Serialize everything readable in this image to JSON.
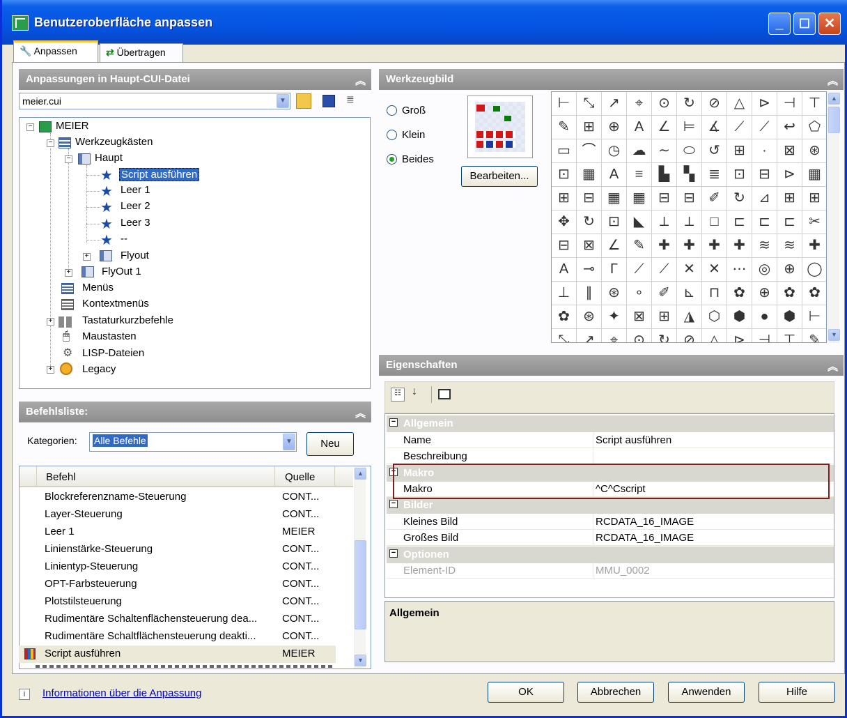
{
  "window": {
    "title": "Benutzeroberfläche anpassen",
    "minimize": "_",
    "maximize": "☐",
    "close": "✕"
  },
  "tabs": [
    {
      "label": "Anpassen"
    },
    {
      "label": "Übertragen"
    }
  ],
  "cui_panel": {
    "title": "Anpassungen in Haupt-CUI-Datei",
    "file": "meier.cui",
    "tree": [
      "MEIER",
      "Werkzeugkästen",
      "Haupt",
      "Script ausführen",
      "Leer 1",
      "Leer 2",
      "Leer 3",
      "--",
      "Flyout",
      "FlyOut 1",
      "Menüs",
      "Kontextmenüs",
      "Tastaturkurzbefehle",
      "Maustasten",
      "LISP-Dateien",
      "Legacy"
    ]
  },
  "commands": {
    "title": "Befehlsliste:",
    "category_label": "Kategorien:",
    "category_value": "Alle Befehle",
    "new_button": "Neu",
    "col_command": "Befehl",
    "col_source": "Quelle",
    "rows": [
      {
        "name": "Blockreferenzname-Steuerung",
        "source": "CONT..."
      },
      {
        "name": "Layer-Steuerung",
        "source": "CONT..."
      },
      {
        "name": "Leer 1",
        "source": "MEIER"
      },
      {
        "name": "Linienstärke-Steuerung",
        "source": "CONT..."
      },
      {
        "name": "Linientyp-Steuerung",
        "source": "CONT..."
      },
      {
        "name": "OPT-Farbsteuerung",
        "source": "CONT..."
      },
      {
        "name": "Plotstilsteuerung",
        "source": "CONT..."
      },
      {
        "name": "Rudimentäre Schaltenflächensteuerung dea...",
        "source": "CONT..."
      },
      {
        "name": "Rudimentäre Schaltflächensteuerung deakti...",
        "source": "CONT..."
      },
      {
        "name": "Script ausführen",
        "source": "MEIER"
      }
    ]
  },
  "toolimage": {
    "title": "Werkzeugbild",
    "size_large": "Groß",
    "size_small": "Klein",
    "size_both": "Beides",
    "edit_button": "Bearbeiten..."
  },
  "properties": {
    "title": "Eigenschaften",
    "cat_general": "Allgemein",
    "name_label": "Name",
    "name_value": "Script ausführen",
    "desc_label": "Beschreibung",
    "cat_macro": "Makro",
    "macro_label": "Makro",
    "macro_value": "^C^Cscript",
    "cat_images": "Bilder",
    "small_label": "Kleines Bild",
    "small_value": "RCDATA_16_IMAGE",
    "large_label": "Großes Bild",
    "large_value": "RCDATA_16_IMAGE",
    "cat_options": "Optionen",
    "id_label": "Element-ID",
    "id_value": "MMU_0002",
    "help_title": "Allgemein"
  },
  "footer": {
    "info_link": "Informationen über die Anpassung",
    "ok": "OK",
    "cancel": "Abbrechen",
    "apply": "Anwenden",
    "help": "Hilfe"
  },
  "colors": {
    "titlebar": "#0454e3",
    "highlight": "#316ac5",
    "macro_outline": "#7a1d1d"
  }
}
